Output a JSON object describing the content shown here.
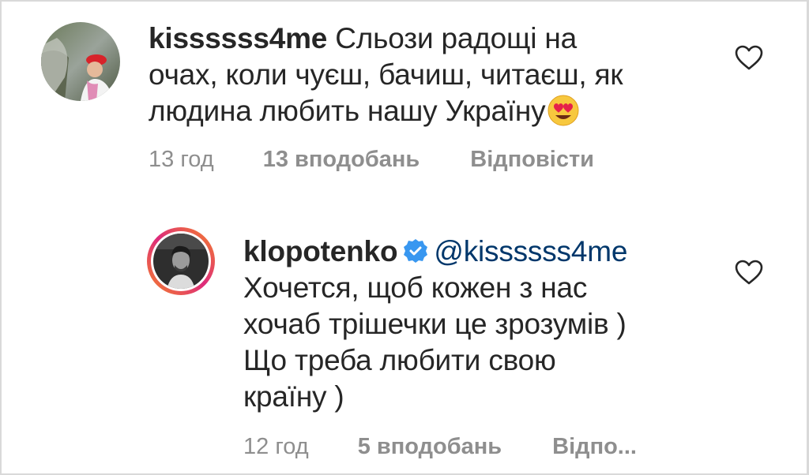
{
  "comments": [
    {
      "username": "kissssss4me",
      "text_line1": " Сльози радощі на",
      "text_line2": "очах, коли чуєш, бачиш, читаєш, як",
      "text_line3": "людина любить нашу Україну",
      "emoji": "heart-eyes-emoji",
      "time": "13 год",
      "likes": "13 вподобань",
      "reply": "Відповісти",
      "like_icon": "heart-outline-icon"
    },
    {
      "username": "klopotenko",
      "verified_icon": "verified-badge-icon",
      "mention": "@kissssss4me",
      "text_line1": "Хочется, щоб кожен з нас",
      "text_line2": "хочаб трішечки це зрозумів )",
      "text_line3": "Що треба любити свою",
      "text_line4": "країну )",
      "time": "12 год",
      "likes": "5 вподобань",
      "reply": "Відпо...",
      "like_icon": "heart-outline-icon"
    }
  ],
  "colors": {
    "text": "#262626",
    "meta": "#8e8e8e",
    "verified": "#3897f0",
    "mention": "#00376b",
    "story_ring_start": "#f58529",
    "story_ring_end": "#dd2a7b"
  }
}
